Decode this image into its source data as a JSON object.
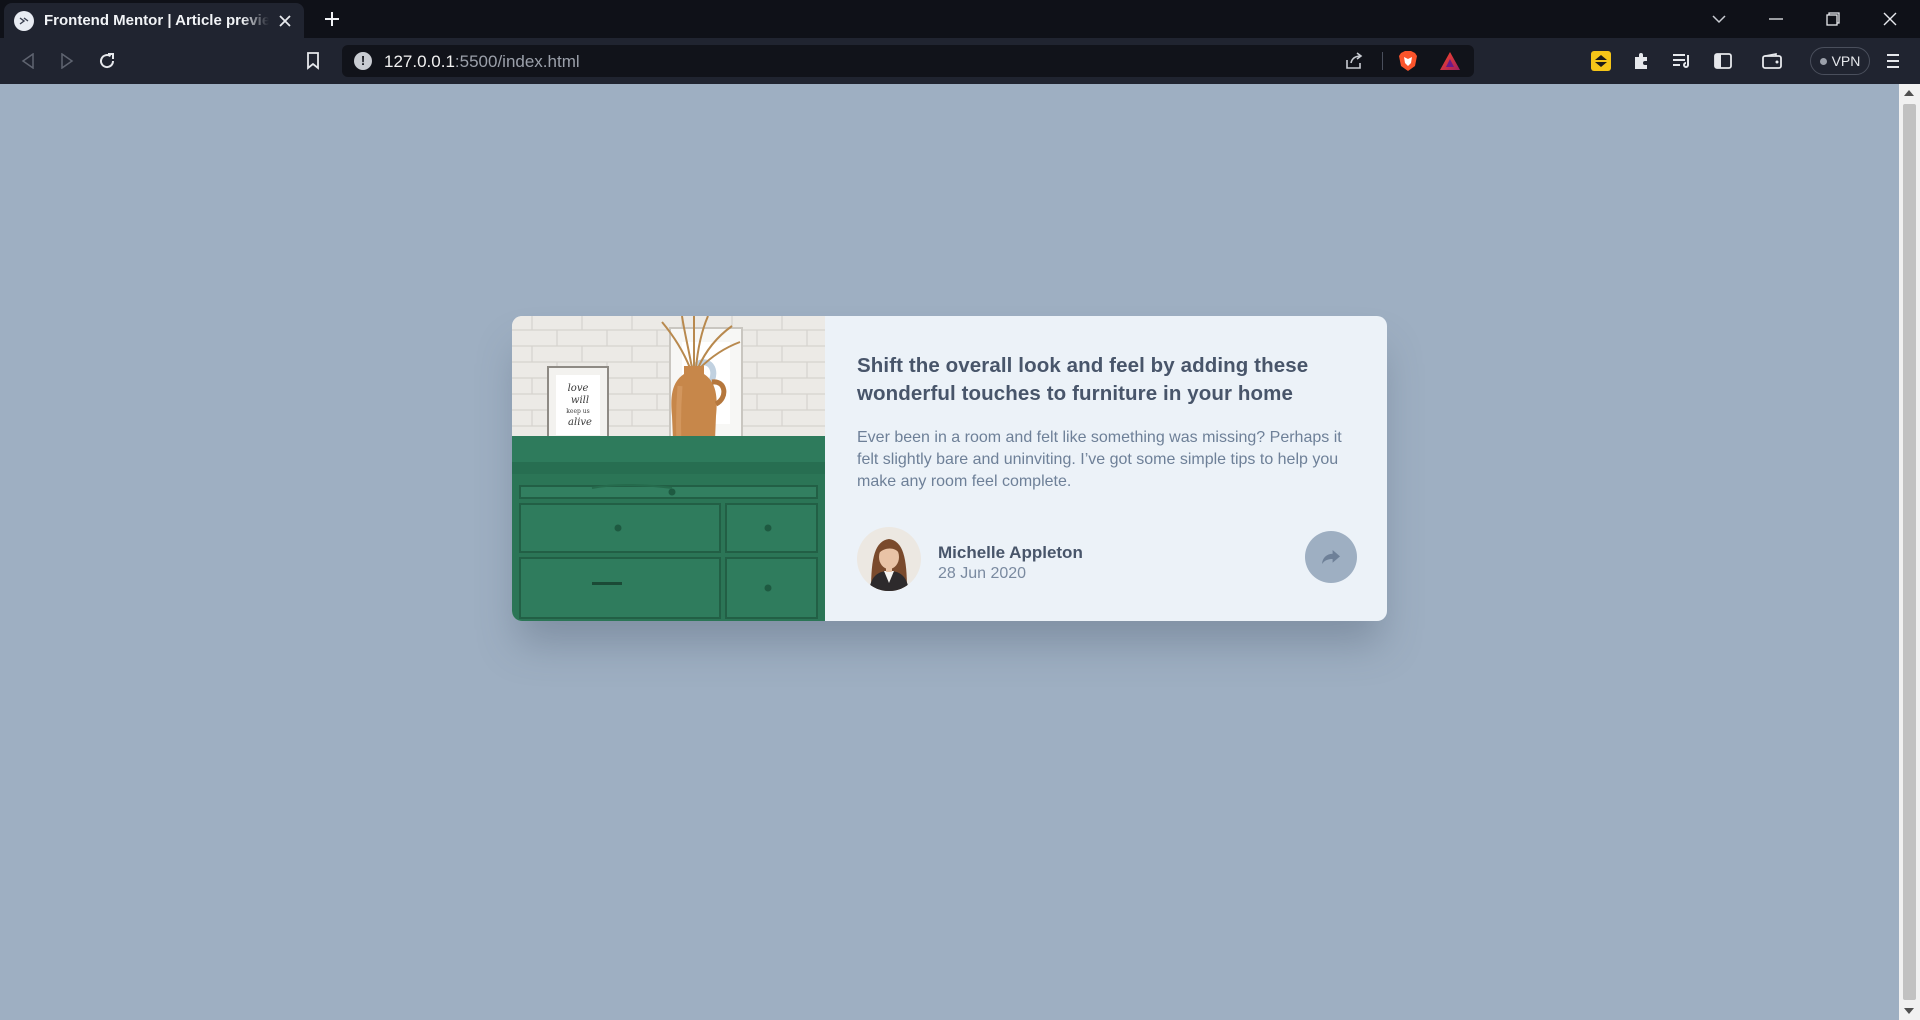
{
  "browser": {
    "tab_title": "Frontend Mentor | Article preview component",
    "url_host": "127.0.0.1",
    "url_path": ":5500/index.html",
    "vpn_label": "VPN"
  },
  "article": {
    "title": "Shift the overall look and feel by adding these wonderful touches to furniture in your home",
    "description": "Ever been in a room and felt like something was missing? Perhaps it felt slightly bare and uninviting. I’ve got some simple tips to help you make any room feel complete.",
    "author_name": "Michelle Appleton",
    "date": "28 Jun 2020",
    "frame_text": "love will keep us alive"
  },
  "colors": {
    "page_background": "#9eafc2",
    "card_background": "#ecf2f8",
    "title_text": "#48556a",
    "body_text": "#6e8098",
    "share_button": "#9eafc2",
    "drawer_green": "#2e7b5c"
  },
  "icons": {
    "share": "share-arrow-icon",
    "back": "back-arrow-icon",
    "forward": "forward-arrow-icon",
    "reload": "reload-icon",
    "bookmark": "bookmark-icon",
    "site_info": "info-icon"
  }
}
